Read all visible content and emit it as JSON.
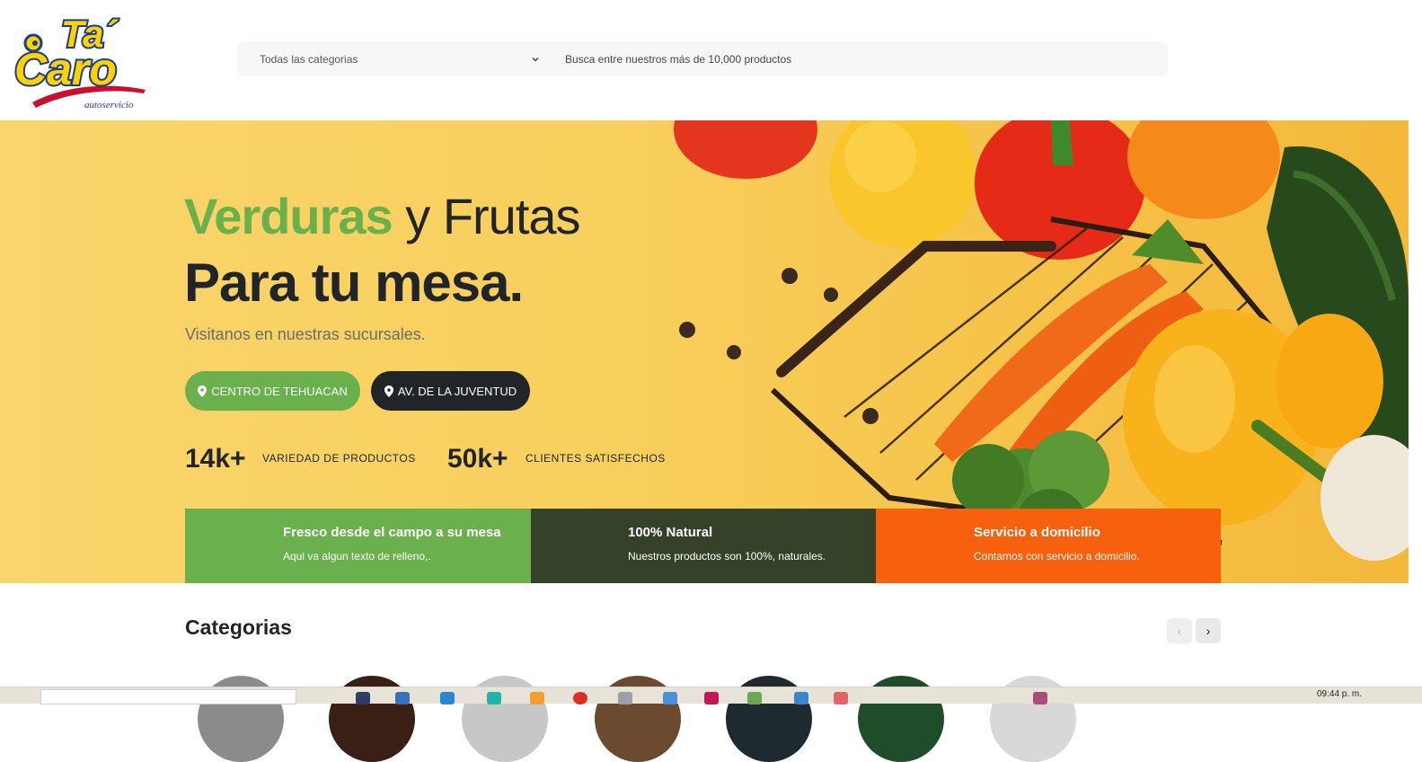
{
  "brand": {
    "name_top": "Ta'",
    "name_bottom": "Caro",
    "tagline": "autoservicio"
  },
  "search": {
    "category_selected": "Todas las categorias",
    "placeholder": "Busca entre nuestros más de 10,000 productos"
  },
  "hero": {
    "title_green": "Verduras",
    "title_rest": " y Frutas",
    "title_line2": "Para tu mesa.",
    "subtitle": "Visitanos en nuestras sucursales.",
    "buttons": [
      {
        "label": "CENTRO DE TEHUACAN"
      },
      {
        "label": "AV. DE LA JUVENTUD"
      }
    ],
    "stats": [
      {
        "value": "14k+",
        "label": "VARIEDAD DE PRODUCTOS"
      },
      {
        "value": "50k+",
        "label": "CLIENTES SATISFECHOS"
      }
    ]
  },
  "features": [
    {
      "title": "Fresco desde el campo a su mesa",
      "text": "Aqui va algun texto de relleno,.",
      "color": "#6ab04c"
    },
    {
      "title": "100% Natural",
      "text": "Nuestros productos son 100%, naturales.",
      "color": "#364129"
    },
    {
      "title": "Servicio a domicilio",
      "text": "Contamos con servicio a domicilio.",
      "color": "#f7600d"
    }
  ],
  "categories": {
    "title": "Categorias",
    "prev_icon": "chevron-left-icon",
    "next_icon": "chevron-right-icon"
  },
  "taskbar": {
    "clock": "09:44 p. m."
  },
  "colors": {
    "accent_green": "#6ab04c",
    "dark": "#212529",
    "orange": "#f7600d",
    "hero_bg": "#f8cf5c"
  }
}
